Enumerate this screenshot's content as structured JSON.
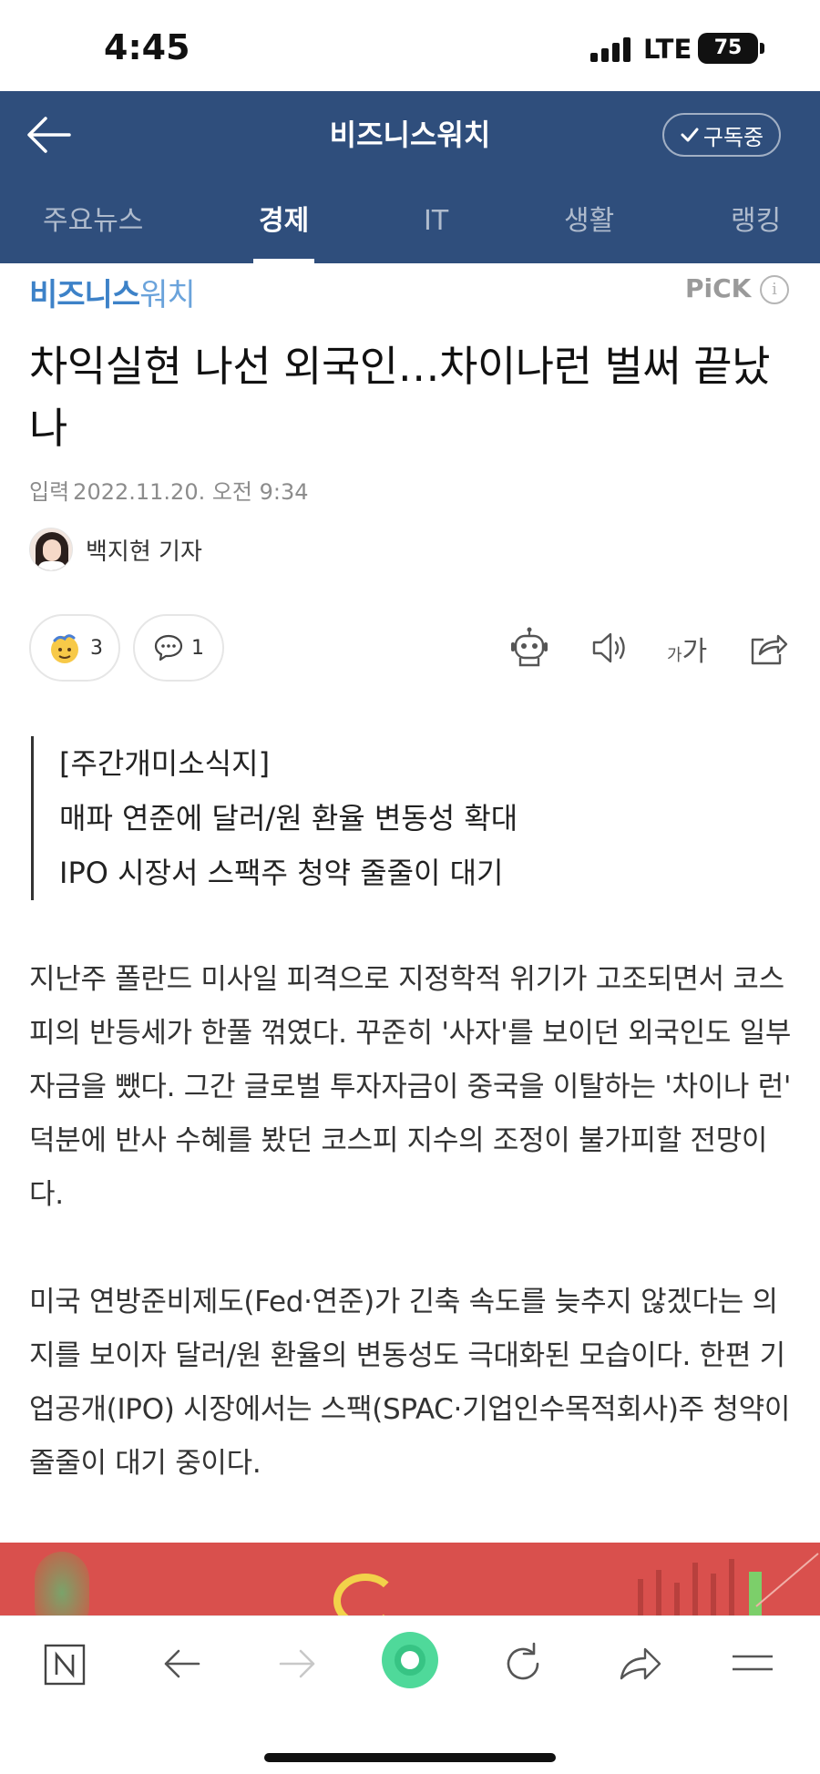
{
  "status_bar": {
    "time": "4:45",
    "network": "LTE",
    "battery": "75"
  },
  "header": {
    "title": "비즈니스워치",
    "subscribe_label": "구독중"
  },
  "tabs": [
    {
      "label": "주요뉴스",
      "active": false
    },
    {
      "label": "경제",
      "active": true
    },
    {
      "label": "IT",
      "active": false
    },
    {
      "label": "생활",
      "active": false
    },
    {
      "label": "랭킹",
      "active": false
    }
  ],
  "press": {
    "logo_main": "비즈니스",
    "logo_sub": "워치",
    "pick_label": "PiCK",
    "info_glyph": "i"
  },
  "article": {
    "headline": "차익실현 나선 외국인…차이나런 벌써 끝났나",
    "date_label": "입력",
    "date": "2022.11.20. 오전 9:34",
    "reporter": "백지현 기자",
    "reaction_count": "3",
    "comment_count": "1",
    "fontsize_small": "가",
    "fontsize_large": "가",
    "summary": [
      "[주간개미소식지]",
      "매파 연준에 달러/원 환율 변동성 확대",
      "IPO 시장서 스팩주 청약 줄줄이 대기"
    ],
    "paragraphs": [
      "지난주 폴란드 미사일 피격으로 지정학적 위기가 고조되면서 코스피의 반등세가 한풀 꺾였다. 꾸준히 '사자'를 보이던 외국인도 일부 자금을 뺐다. 그간 글로벌 투자자금이 중국을 이탈하는 '차이나 런' 덕분에 반사 수혜를 봤던 코스피 지수의 조정이 불가피할 전망이다.",
      "미국 연방준비제도(Fed·연준)가 긴축 속도를 늦추지 않겠다는 의지를 보이자 달러/원 환율의 변동성도 극대화된 모습이다. 한편 기업공개(IPO) 시장에서는 스팩(SPAC·기업인수목적회사)주 청약이 줄줄이 대기 중이다."
    ]
  },
  "colors": {
    "header_bg": "#2f4e7c",
    "logo_blue": "#3d82c8",
    "image_red": "#d9504d",
    "green_button": "#4fd99a"
  }
}
